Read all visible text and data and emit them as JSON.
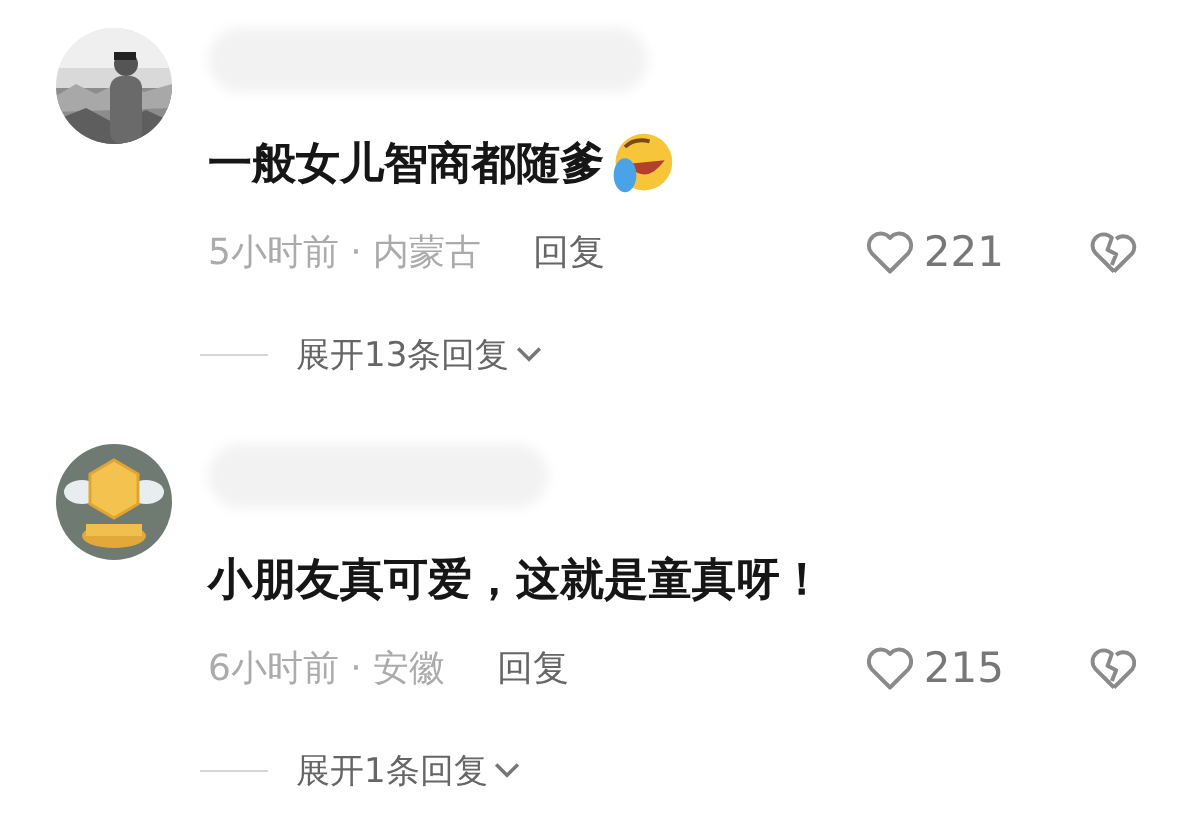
{
  "comments": [
    {
      "text": "一般女儿智商都随爹",
      "has_emoji": true,
      "meta": "5小时前 · 内蒙古",
      "reply": "回复",
      "likes": "221",
      "expand": "展开13条回复"
    },
    {
      "avatar": {
        "kind": "badge"
      },
      "text": "小朋友真可爱，这就是童真呀！",
      "has_emoji": false,
      "meta": "6小时前 · 安徽",
      "reply": "回复",
      "likes": "215",
      "expand": "展开1条回复"
    }
  ]
}
